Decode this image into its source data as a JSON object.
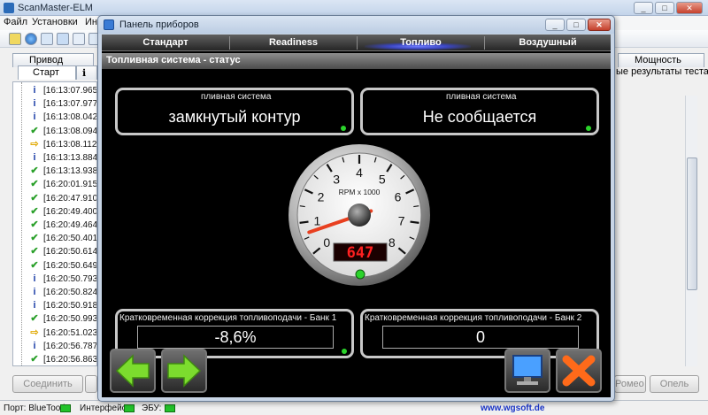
{
  "main_window": {
    "title": "ScanMaster-ELM",
    "menu": [
      "Файл",
      "Установки",
      "Ин"
    ],
    "tabs": {
      "drive": "Привод",
      "start": "Старт",
      "power": "Мощность",
      "results": "ые результаты теста"
    },
    "log_entries": [
      {
        "time": "[16:13:07.965]",
        "icon": "info-icon"
      },
      {
        "time": "[16:13:07.977]",
        "icon": "info-icon"
      },
      {
        "time": "[16:13:08.042]",
        "icon": "info-icon"
      },
      {
        "time": "[16:13:08.094]",
        "icon": "check-icon"
      },
      {
        "time": "[16:13:08.112]",
        "icon": "arrow-icon"
      },
      {
        "time": "[16:13:13.884]",
        "icon": "info-icon"
      },
      {
        "time": "[16:13:13.938]",
        "icon": "check-icon"
      },
      {
        "time": "[16:20:01.915]",
        "icon": "check-icon"
      },
      {
        "time": "[16:20:47.910]",
        "icon": "check-icon"
      },
      {
        "time": "[16:20:49.400]",
        "icon": "check-icon"
      },
      {
        "time": "[16:20:49.464]",
        "icon": "check-icon"
      },
      {
        "time": "[16:20:50.401]",
        "icon": "check-icon"
      },
      {
        "time": "[16:20:50.614]",
        "icon": "check-icon"
      },
      {
        "time": "[16:20:50.649]",
        "icon": "check-icon"
      },
      {
        "time": "[16:20:50.793]",
        "icon": "info-icon"
      },
      {
        "time": "[16:20:50.824]",
        "icon": "info-icon"
      },
      {
        "time": "[16:20:50.918]",
        "icon": "info-icon"
      },
      {
        "time": "[16:20:50.993]",
        "icon": "check-icon"
      },
      {
        "time": "[16:20:51.023]",
        "icon": "arrow-icon"
      },
      {
        "time": "[16:20:56.787]",
        "icon": "info-icon"
      },
      {
        "time": "[16:20:56.863]",
        "icon": "check-icon"
      }
    ],
    "buttons": {
      "connect": "Соединить",
      "romeo": "Ромео",
      "opel": "Опель"
    },
    "status": {
      "port": "Порт: BlueTooth",
      "interface": "Интерфейс:",
      "ecu": "ЭБУ:",
      "site": "www.wgsoft.de"
    }
  },
  "dashboard": {
    "title": "Панель приборов",
    "tabs": [
      "Стандарт",
      "Readiness",
      "Топливо",
      "Воздушный"
    ],
    "active_tab": "Топливо",
    "section_title": "Топливная система - статус",
    "panels": {
      "fuel_system_1": {
        "label": "пливная система",
        "value": "замкнутый контур",
        "led": "#2bd32b"
      },
      "fuel_system_2": {
        "label": "пливная система",
        "value": "Не сообщается",
        "led": "#2bd32b"
      },
      "stft_bank1": {
        "label": "Кратковременная коррекция топливоподачи - Банк 1",
        "value": "-8,6%",
        "led": "#2bd32b"
      },
      "stft_bank2": {
        "label": "Кратковременная коррекция топливоподачи - Банк 2",
        "value": "0",
        "led": "#e02020"
      }
    },
    "gauge": {
      "unit_label": "RPM x 1000",
      "ticks": [
        "0",
        "1",
        "2",
        "3",
        "4",
        "5",
        "6",
        "7",
        "8"
      ],
      "min": 0,
      "max": 8,
      "value_rpm": 647,
      "digital_readout": "647",
      "led": "#2bd32b"
    },
    "colors": {
      "panel_border": "#c8c8c8",
      "active_tab_glow": "#5a66ff",
      "needle": "#e84020",
      "digital": "#ff2020"
    }
  }
}
